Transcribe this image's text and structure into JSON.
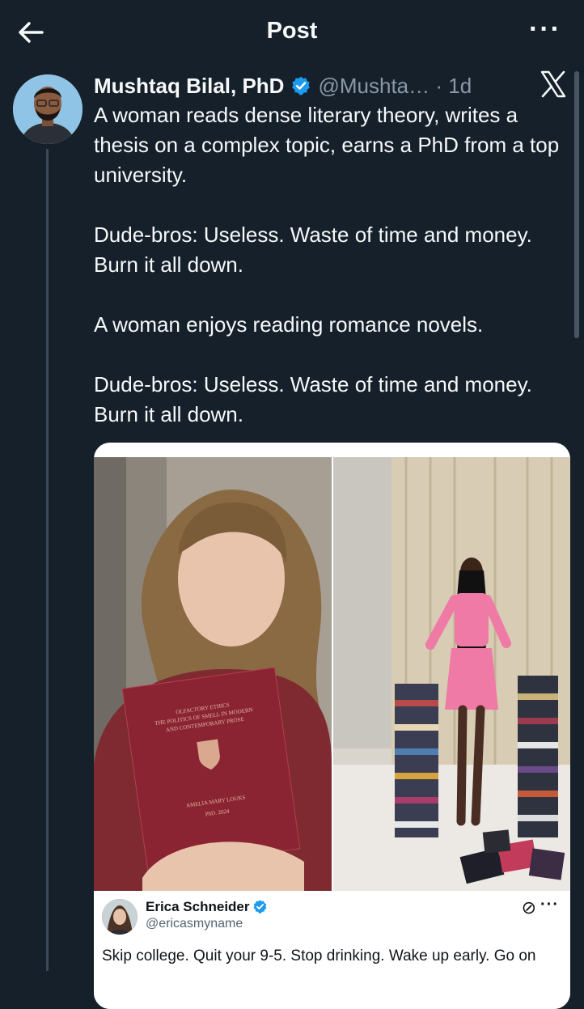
{
  "header": {
    "title": "Post"
  },
  "tweet": {
    "author_name": "Mushtaq Bilal, PhD",
    "handle_time": "@Mushta… · 1d",
    "paragraphs": [
      "A woman reads dense literary theory, writes a thesis on a complex topic, earns a PhD from a top university.",
      "Dude-bros: Useless. Waste of time and money. Burn it all down.",
      "A woman enjoys reading romance novels.",
      "Dude-bros: Useless. Waste of time and money. Burn it all down."
    ]
  },
  "media": {
    "book_cover_lines": [
      "OLFACTORY ETHICS",
      "THE POLITICS OF SMELL IN MODERN",
      "AND CONTEMPORARY PROSE",
      "AMELIA MARY LOUKS",
      "PhD. 2024"
    ],
    "quote": {
      "name": "Erica Schneider",
      "handle": "@ericasmyname",
      "text": "Skip college. Quit your 9-5. Stop drinking. Wake up early. Go on"
    }
  },
  "colors": {
    "background": "#15202b",
    "verified": "#1d9bf0",
    "secondary_text": "#8b98a5"
  },
  "icons": {
    "back": "arrow-left-icon",
    "more": "more-horizontal-icon",
    "verified": "verified-badge-icon",
    "x_logo": "x-logo-icon"
  }
}
